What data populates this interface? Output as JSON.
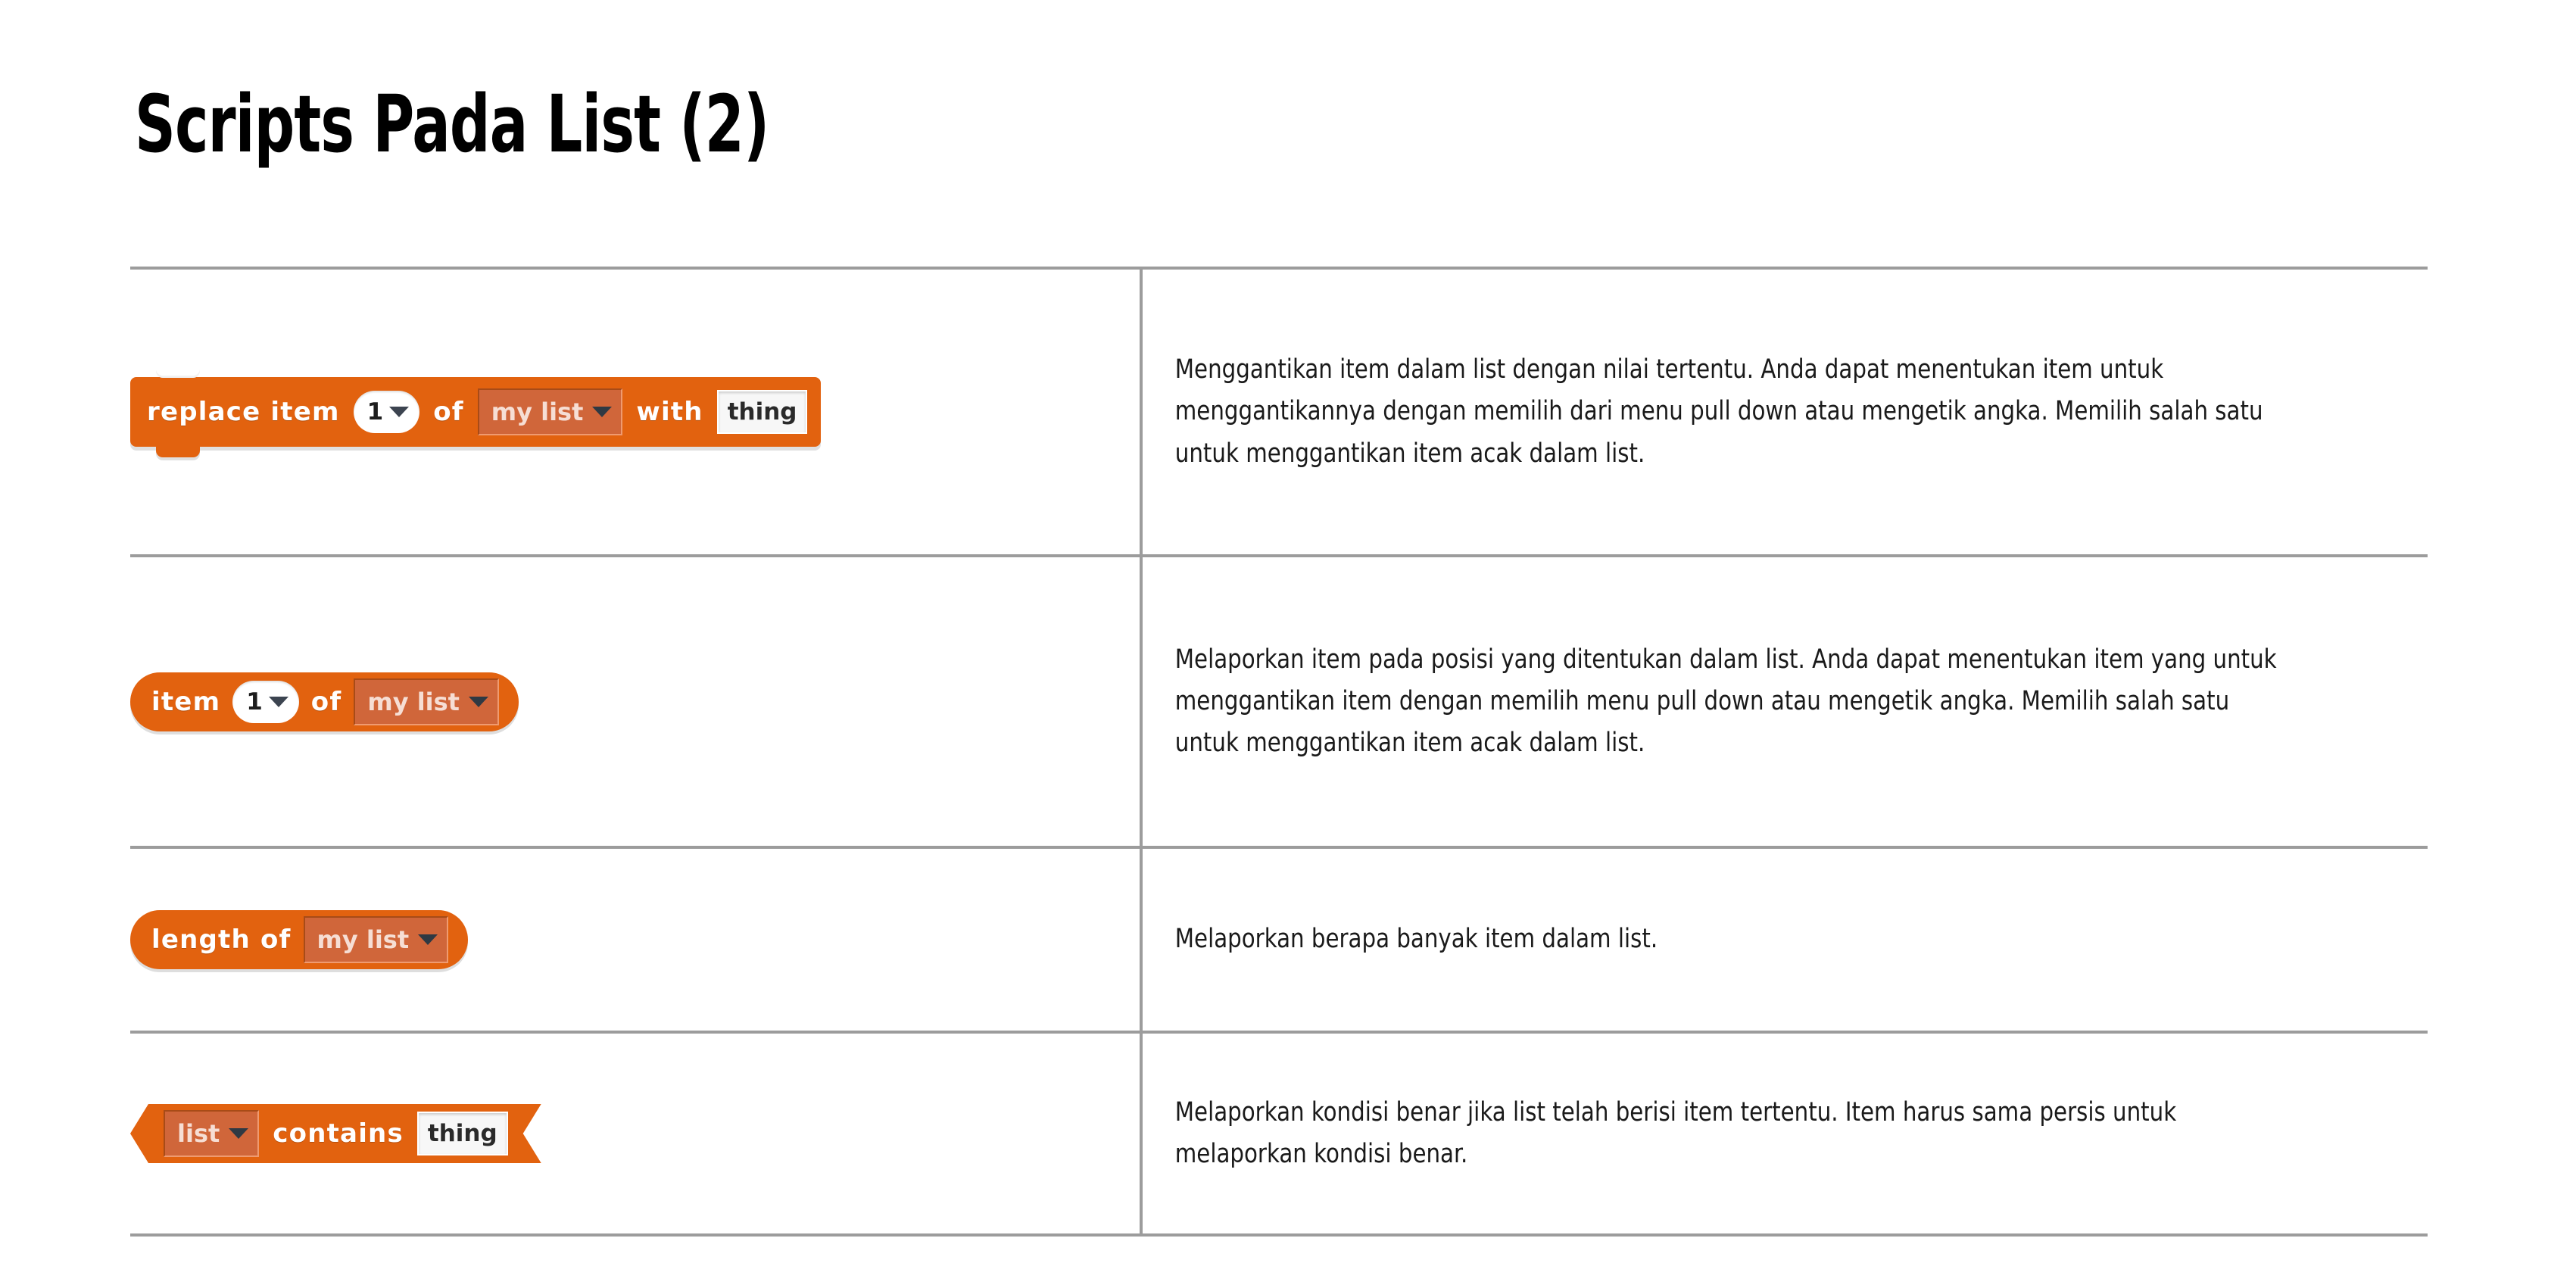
{
  "title": "Scripts Pada List (2)",
  "theme": {
    "block_orange": "#E2620F",
    "dropdown_inset": "#D0663A",
    "rule_gray": "#9C9C9C",
    "text_color": "#1A1A1A"
  },
  "table": {
    "rows": [
      {
        "block": {
          "shape": "stack",
          "name": "replace-item-block",
          "parts": [
            {
              "type": "label",
              "text": "replace item"
            },
            {
              "type": "numdrop",
              "value": "1"
            },
            {
              "type": "label",
              "text": "of"
            },
            {
              "type": "dropdown",
              "value": "my list"
            },
            {
              "type": "label",
              "text": "with"
            },
            {
              "type": "textinput",
              "value": "thing"
            }
          ]
        },
        "description": "Menggantikan item dalam list dengan nilai tertentu. Anda dapat menentukan item untuk menggantikannya dengan memilih dari menu pull down atau mengetik angka. Memilih salah satu untuk menggantikan item acak dalam list."
      },
      {
        "block": {
          "shape": "reporter",
          "name": "item-of-block",
          "parts": [
            {
              "type": "label",
              "text": "item"
            },
            {
              "type": "numdrop",
              "value": "1"
            },
            {
              "type": "label",
              "text": "of"
            },
            {
              "type": "dropdown",
              "value": "my list"
            }
          ]
        },
        "description": "Melaporkan item pada posisi yang ditentukan dalam list. Anda dapat menentukan item yang untuk menggantikan item dengan memilih menu pull down atau mengetik angka. Memilih salah  satu untuk menggantikan item acak dalam list."
      },
      {
        "block": {
          "shape": "reporter",
          "name": "length-of-block",
          "parts": [
            {
              "type": "label",
              "text": "length of"
            },
            {
              "type": "dropdown",
              "value": "my list"
            }
          ]
        },
        "description": "Melaporkan berapa banyak item dalam list."
      },
      {
        "block": {
          "shape": "boolean",
          "name": "list-contains-block",
          "parts": [
            {
              "type": "dropdown",
              "value": "list"
            },
            {
              "type": "label",
              "text": "contains"
            },
            {
              "type": "textinput",
              "value": "thing"
            }
          ]
        },
        "description": "Melaporkan kondisi benar jika list telah berisi item tertentu. Item harus sama persis untuk melaporkan kondisi benar."
      }
    ]
  }
}
